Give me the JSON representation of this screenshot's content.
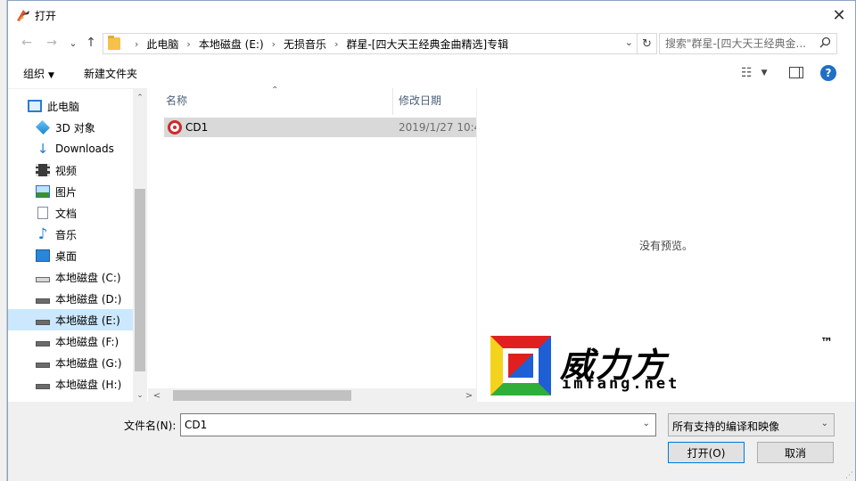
{
  "window": {
    "title": "打开",
    "close_glyph": "✕"
  },
  "nav": {
    "back": "←",
    "forward": "→",
    "recent": "⌄",
    "up": "↑"
  },
  "address": {
    "crumbs": [
      "此电脑",
      "本地磁盘 (E:)",
      "无损音乐",
      "群星-[四大天王经典金曲精选]专辑"
    ],
    "separator": "›",
    "dropdown_glyph": "⌄",
    "refresh_glyph": "↻"
  },
  "search": {
    "placeholder": "搜索\"群星-[四大天王经典金...",
    "icon": "search-icon"
  },
  "toolbar": {
    "organize_label": "组织",
    "new_folder_label": "新建文件夹",
    "view_glyph": "☷",
    "caret": "▼",
    "help_label": "?"
  },
  "sidebar": {
    "items": [
      {
        "label": "此电脑",
        "icon": "computer-icon"
      },
      {
        "label": "3D 对象",
        "icon": "3d-objects-icon"
      },
      {
        "label": "Downloads",
        "icon": "download-icon"
      },
      {
        "label": "视频",
        "icon": "video-icon"
      },
      {
        "label": "图片",
        "icon": "pictures-icon"
      },
      {
        "label": "文档",
        "icon": "documents-icon"
      },
      {
        "label": "音乐",
        "icon": "music-icon"
      },
      {
        "label": "桌面",
        "icon": "desktop-icon"
      },
      {
        "label": "本地磁盘 (C:)",
        "icon": "system-drive-icon"
      },
      {
        "label": "本地磁盘 (D:)",
        "icon": "drive-icon"
      },
      {
        "label": "本地磁盘 (E:)",
        "icon": "drive-icon",
        "selected": true
      },
      {
        "label": "本地磁盘 (F:)",
        "icon": "drive-icon"
      },
      {
        "label": "本地磁盘 (G:)",
        "icon": "drive-icon"
      },
      {
        "label": "本地磁盘 (H:)",
        "icon": "drive-icon"
      }
    ],
    "scroll_up": "⌃",
    "scroll_down": "⌄"
  },
  "filelist": {
    "columns": [
      "名称",
      "修改日期"
    ],
    "sort_glyph": "⌃",
    "rows": [
      {
        "name": "CD1",
        "date": "2019/1/27 10:4",
        "icon": "netease-music-icon"
      }
    ],
    "scroll_left": "<",
    "scroll_right": ">"
  },
  "preview": {
    "message": "没有预览。",
    "watermark": {
      "brand": "威力方",
      "trademark": "™",
      "url": "imfang.net"
    }
  },
  "bottom": {
    "filename_label": "文件名(N):",
    "filename_value": "CD1",
    "dropdown_glyph": "⌄",
    "filter_value": "所有支持的编译和映像",
    "open_label": "打开(O)",
    "cancel_label": "取消",
    "grip": "⋰"
  },
  "colors": {
    "selection": "#cce8ff",
    "accent": "#0078d7",
    "help": "#1f6fc6"
  }
}
